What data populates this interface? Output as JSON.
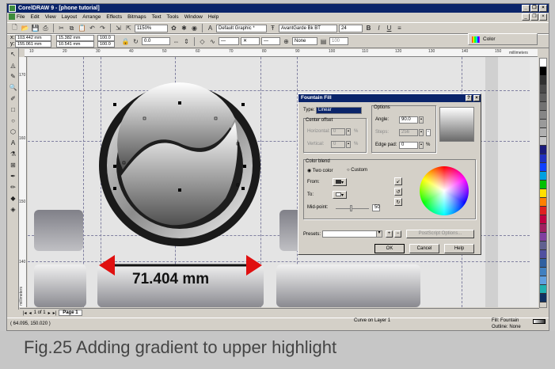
{
  "window": {
    "title": "CorelDRAW 9 - [phone tutorial]"
  },
  "menu": [
    "File",
    "Edit",
    "View",
    "Layout",
    "Arrange",
    "Effects",
    "Bitmaps",
    "Text",
    "Tools",
    "Window",
    "Help"
  ],
  "toolbar1": {
    "zoom": "1150%",
    "style": "Default Graphic *",
    "font": "AvantGarde Bk BT",
    "font_size": "24",
    "bold": "B",
    "italic": "I",
    "underline": "U"
  },
  "toolbar2": {
    "x": "103.442 mm",
    "y": "155.061 mm",
    "w": "15.382 mm",
    "h": "10.541 mm",
    "sx": "100.0",
    "sy": "100.0",
    "angle": "0.0",
    "outline": "None",
    "opacity": "100",
    "color_label": "Color"
  },
  "ruler": {
    "h_ticks": [
      "10",
      "20",
      "30",
      "40",
      "50",
      "60",
      "70",
      "80",
      "90",
      "100",
      "110",
      "120",
      "130",
      "140",
      "150"
    ],
    "h_unit": "millimeters",
    "v_unit": "millimeters",
    "v_ticks": [
      "170",
      "160",
      "150",
      "140"
    ]
  },
  "dimension": {
    "label": "71.404 mm",
    "arrow_color": "#e01010"
  },
  "dialog": {
    "title": "Fountain Fill",
    "type_label": "Type:",
    "type_value": "Linear",
    "center_offset": "Center offset",
    "horizontal": "Horizontal:",
    "horizontal_val": "0",
    "vertical": "Vertical:",
    "vertical_val": "0",
    "pct": "%",
    "options": "Options",
    "angle_label": "Angle:",
    "angle_val": "90.0",
    "steps_label": "Steps:",
    "steps_val": "256",
    "edge_label": "Edge pad:",
    "edge_val": "0",
    "color_blend": "Color blend",
    "two_color": "Two color",
    "custom": "Custom",
    "from": "From:",
    "to": "To:",
    "midpoint": "Mid-point:",
    "midpoint_val": "50",
    "presets": "Presets:",
    "postscript": "PostScript Options...",
    "ok": "OK",
    "cancel": "Cancel",
    "help": "Help"
  },
  "pagebar": {
    "pager": "1 of 1",
    "page_tab": "Page 1"
  },
  "status": {
    "coords": "( 64.095, 150.020 )",
    "object": "Curve on Layer 1",
    "fill": "Fill: Fountain",
    "outline": "Outline: None"
  },
  "caption": "Fig.25  Adding gradient to upper highlight",
  "palette": [
    "#ffffff",
    "#000000",
    "#303030",
    "#4a4a4a",
    "#5e5e5e",
    "#727272",
    "#868686",
    "#9a9a9a",
    "#b0b0b0",
    "#c8c8c8",
    "#1a1a7a",
    "#2030c0",
    "#1040ff",
    "#00a0e0",
    "#00c000",
    "#ffe000",
    "#ff8000",
    "#e02020",
    "#c00040",
    "#a02060",
    "#8040a0",
    "#606090",
    "#5050a0",
    "#3060a0",
    "#4080c0",
    "#60a0e0",
    "#20b0b0",
    "#103060"
  ]
}
